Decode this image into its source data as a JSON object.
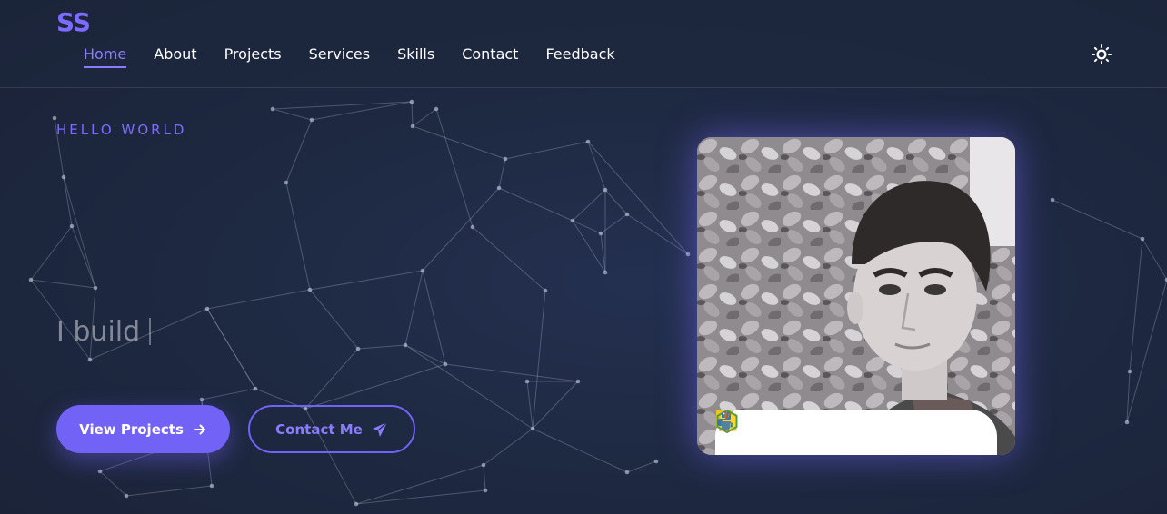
{
  "brand": {
    "logo_text": "SS",
    "accent_color": "#7262f5"
  },
  "nav": {
    "items": [
      {
        "label": "Home",
        "active": true
      },
      {
        "label": "About",
        "active": false
      },
      {
        "label": "Projects",
        "active": false
      },
      {
        "label": "Services",
        "active": false
      },
      {
        "label": "Skills",
        "active": false
      },
      {
        "label": "Contact",
        "active": false
      },
      {
        "label": "Feedback",
        "active": false
      }
    ],
    "theme_toggle_icon": "sun-icon"
  },
  "hero": {
    "eyebrow": "HELLO WORLD",
    "typing_text": "I build",
    "primary_button": {
      "label": "View Projects",
      "icon": "arrow-right-icon"
    },
    "secondary_button": {
      "label": "Contact Me",
      "icon": "paper-plane-icon"
    }
  },
  "profile": {
    "photo_icon": "profile-photo",
    "tech_icons": [
      "react-icon",
      "javascript-icon",
      "nodejs-icon",
      "python-icon",
      "java-icon"
    ]
  },
  "colors": {
    "background": "#1e2942",
    "accent": "#7262f5",
    "accent_light": "#8b7cff"
  }
}
